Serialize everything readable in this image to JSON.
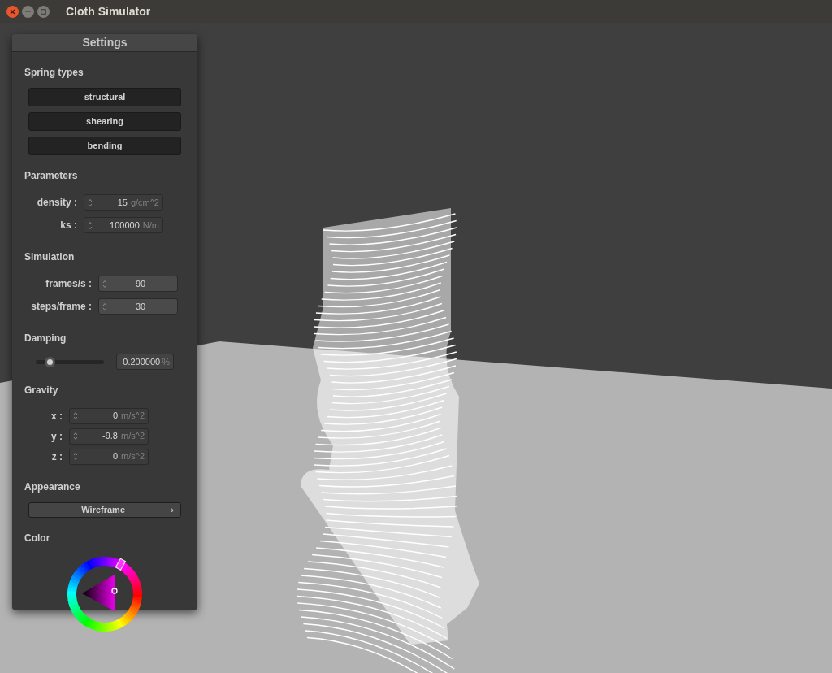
{
  "window": {
    "title": "Cloth Simulator"
  },
  "settings": {
    "title": "Settings",
    "spring_types": {
      "heading": "Spring types",
      "buttons": [
        "structural",
        "shearing",
        "bending"
      ]
    },
    "parameters": {
      "heading": "Parameters",
      "fields": [
        {
          "label": "density :",
          "value": "15",
          "unit": "g/cm^2"
        },
        {
          "label": "ks :",
          "value": "100000",
          "unit": "N/m"
        }
      ]
    },
    "simulation": {
      "heading": "Simulation",
      "fields": [
        {
          "label": "frames/s :",
          "value": "90"
        },
        {
          "label": "steps/frame :",
          "value": "30"
        }
      ]
    },
    "damping": {
      "heading": "Damping",
      "level": 0.2,
      "value": "0.200000",
      "unit": "%"
    },
    "gravity": {
      "heading": "Gravity",
      "fields": [
        {
          "label": "x :",
          "value": "0",
          "unit": "m/s^2"
        },
        {
          "label": "y :",
          "value": "-9.8",
          "unit": "m/s^2"
        },
        {
          "label": "z :",
          "value": "0",
          "unit": "m/s^2"
        }
      ]
    },
    "appearance": {
      "heading": "Appearance",
      "value": "Wireframe",
      "arrow": "›"
    },
    "color": {
      "heading": "Color"
    }
  }
}
